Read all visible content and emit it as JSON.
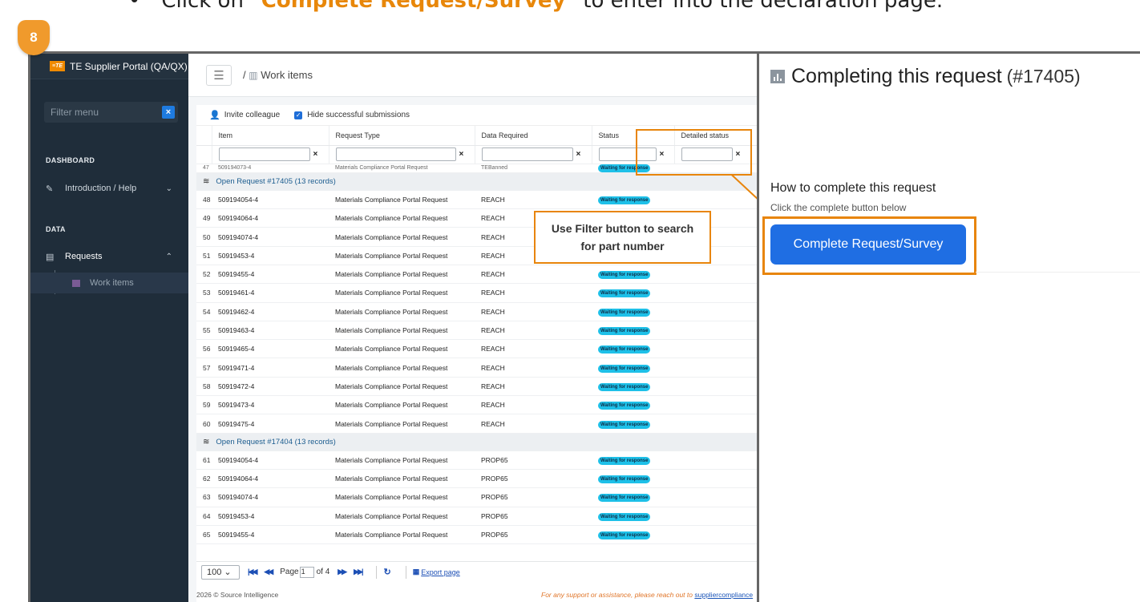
{
  "instruction": {
    "prefix": "Click on ",
    "highlight": "\"Complete Request/Survey\"",
    "suffix": " to enter into the declaration page."
  },
  "step": "8",
  "app": {
    "logo": "≡TE",
    "title": "TE Supplier Portal (QA/QX)",
    "filter_placeholder": "Filter menu",
    "filter_clear": "×",
    "sections": {
      "dashboard": "DASHBOARD",
      "data": "DATA"
    },
    "nav": {
      "intro": "Introduction / Help",
      "requests": "Requests",
      "work_items": "Work items"
    }
  },
  "breadcrumb": {
    "sep": "/",
    "label": "Work items"
  },
  "toolbar": {
    "invite": "Invite colleague",
    "hide": "Hide successful submissions"
  },
  "columns": [
    "Item",
    "Request Type",
    "Data Required",
    "Status",
    "Detailed status"
  ],
  "partial_row": {
    "num": "47",
    "item": "509194073-4",
    "type": "Materials Compliance Portal Request",
    "data": "TEBanned"
  },
  "groups": [
    {
      "label": "Open Request #17405 (13 records)",
      "rows": [
        {
          "num": "48",
          "item": "509194054-4",
          "type": "Materials Compliance Portal Request",
          "data": "REACH",
          "status": "Waiting for response"
        },
        {
          "num": "49",
          "item": "509194064-4",
          "type": "Materials Compliance Portal Request",
          "data": "REACH",
          "status": "Waiting for response"
        },
        {
          "num": "50",
          "item": "509194074-4",
          "type": "Materials Compliance Portal Request",
          "data": "REACH",
          "status": "Waiting for response"
        },
        {
          "num": "51",
          "item": "50919453-4",
          "type": "Materials Compliance Portal Request",
          "data": "REACH",
          "status": "Waiting for response"
        },
        {
          "num": "52",
          "item": "50919455-4",
          "type": "Materials Compliance Portal Request",
          "data": "REACH",
          "status": "Waiting for response"
        },
        {
          "num": "53",
          "item": "50919461-4",
          "type": "Materials Compliance Portal Request",
          "data": "REACH",
          "status": "Waiting for response"
        },
        {
          "num": "54",
          "item": "50919462-4",
          "type": "Materials Compliance Portal Request",
          "data": "REACH",
          "status": "Waiting for response"
        },
        {
          "num": "55",
          "item": "50919463-4",
          "type": "Materials Compliance Portal Request",
          "data": "REACH",
          "status": "Waiting for response"
        },
        {
          "num": "56",
          "item": "50919465-4",
          "type": "Materials Compliance Portal Request",
          "data": "REACH",
          "status": "Waiting for response"
        },
        {
          "num": "57",
          "item": "50919471-4",
          "type": "Materials Compliance Portal Request",
          "data": "REACH",
          "status": "Waiting for response"
        },
        {
          "num": "58",
          "item": "50919472-4",
          "type": "Materials Compliance Portal Request",
          "data": "REACH",
          "status": "Waiting for response"
        },
        {
          "num": "59",
          "item": "50919473-4",
          "type": "Materials Compliance Portal Request",
          "data": "REACH",
          "status": "Waiting for response"
        },
        {
          "num": "60",
          "item": "50919475-4",
          "type": "Materials Compliance Portal Request",
          "data": "REACH",
          "status": "Waiting for response"
        }
      ]
    },
    {
      "label": "Open Request #17404 (13 records)",
      "rows": [
        {
          "num": "61",
          "item": "509194054-4",
          "type": "Materials Compliance Portal Request",
          "data": "PROP65",
          "status": "Waiting for response"
        },
        {
          "num": "62",
          "item": "509194064-4",
          "type": "Materials Compliance Portal Request",
          "data": "PROP65",
          "status": "Waiting for response"
        },
        {
          "num": "63",
          "item": "509194074-4",
          "type": "Materials Compliance Portal Request",
          "data": "PROP65",
          "status": "Waiting for response"
        },
        {
          "num": "64",
          "item": "50919453-4",
          "type": "Materials Compliance Portal Request",
          "data": "PROP65",
          "status": "Waiting for response"
        },
        {
          "num": "65",
          "item": "50919455-4",
          "type": "Materials Compliance Portal Request",
          "data": "PROP65",
          "status": "Waiting for response"
        }
      ]
    }
  ],
  "pager": {
    "size": "100",
    "page_label": "Page",
    "page": "1",
    "of": "of 4",
    "export": "Export page"
  },
  "footer": {
    "left": "2026 © Source Intelligence",
    "right": "For any support or assistance, please reach out to ",
    "link": "suppliercompliance"
  },
  "callout": "Use Filter button to search for part number",
  "right_panel": {
    "title": "Completing this request",
    "request_no": "(#17405)",
    "how_title": "How to complete this request",
    "how_sub": "Click the complete button below",
    "button": "Complete Request/Survey"
  },
  "colors": {
    "accent": "#e8850c",
    "primary": "#1f6ee3",
    "sidebar": "#1f2d3a",
    "status_pill": "#1ec0e8"
  }
}
